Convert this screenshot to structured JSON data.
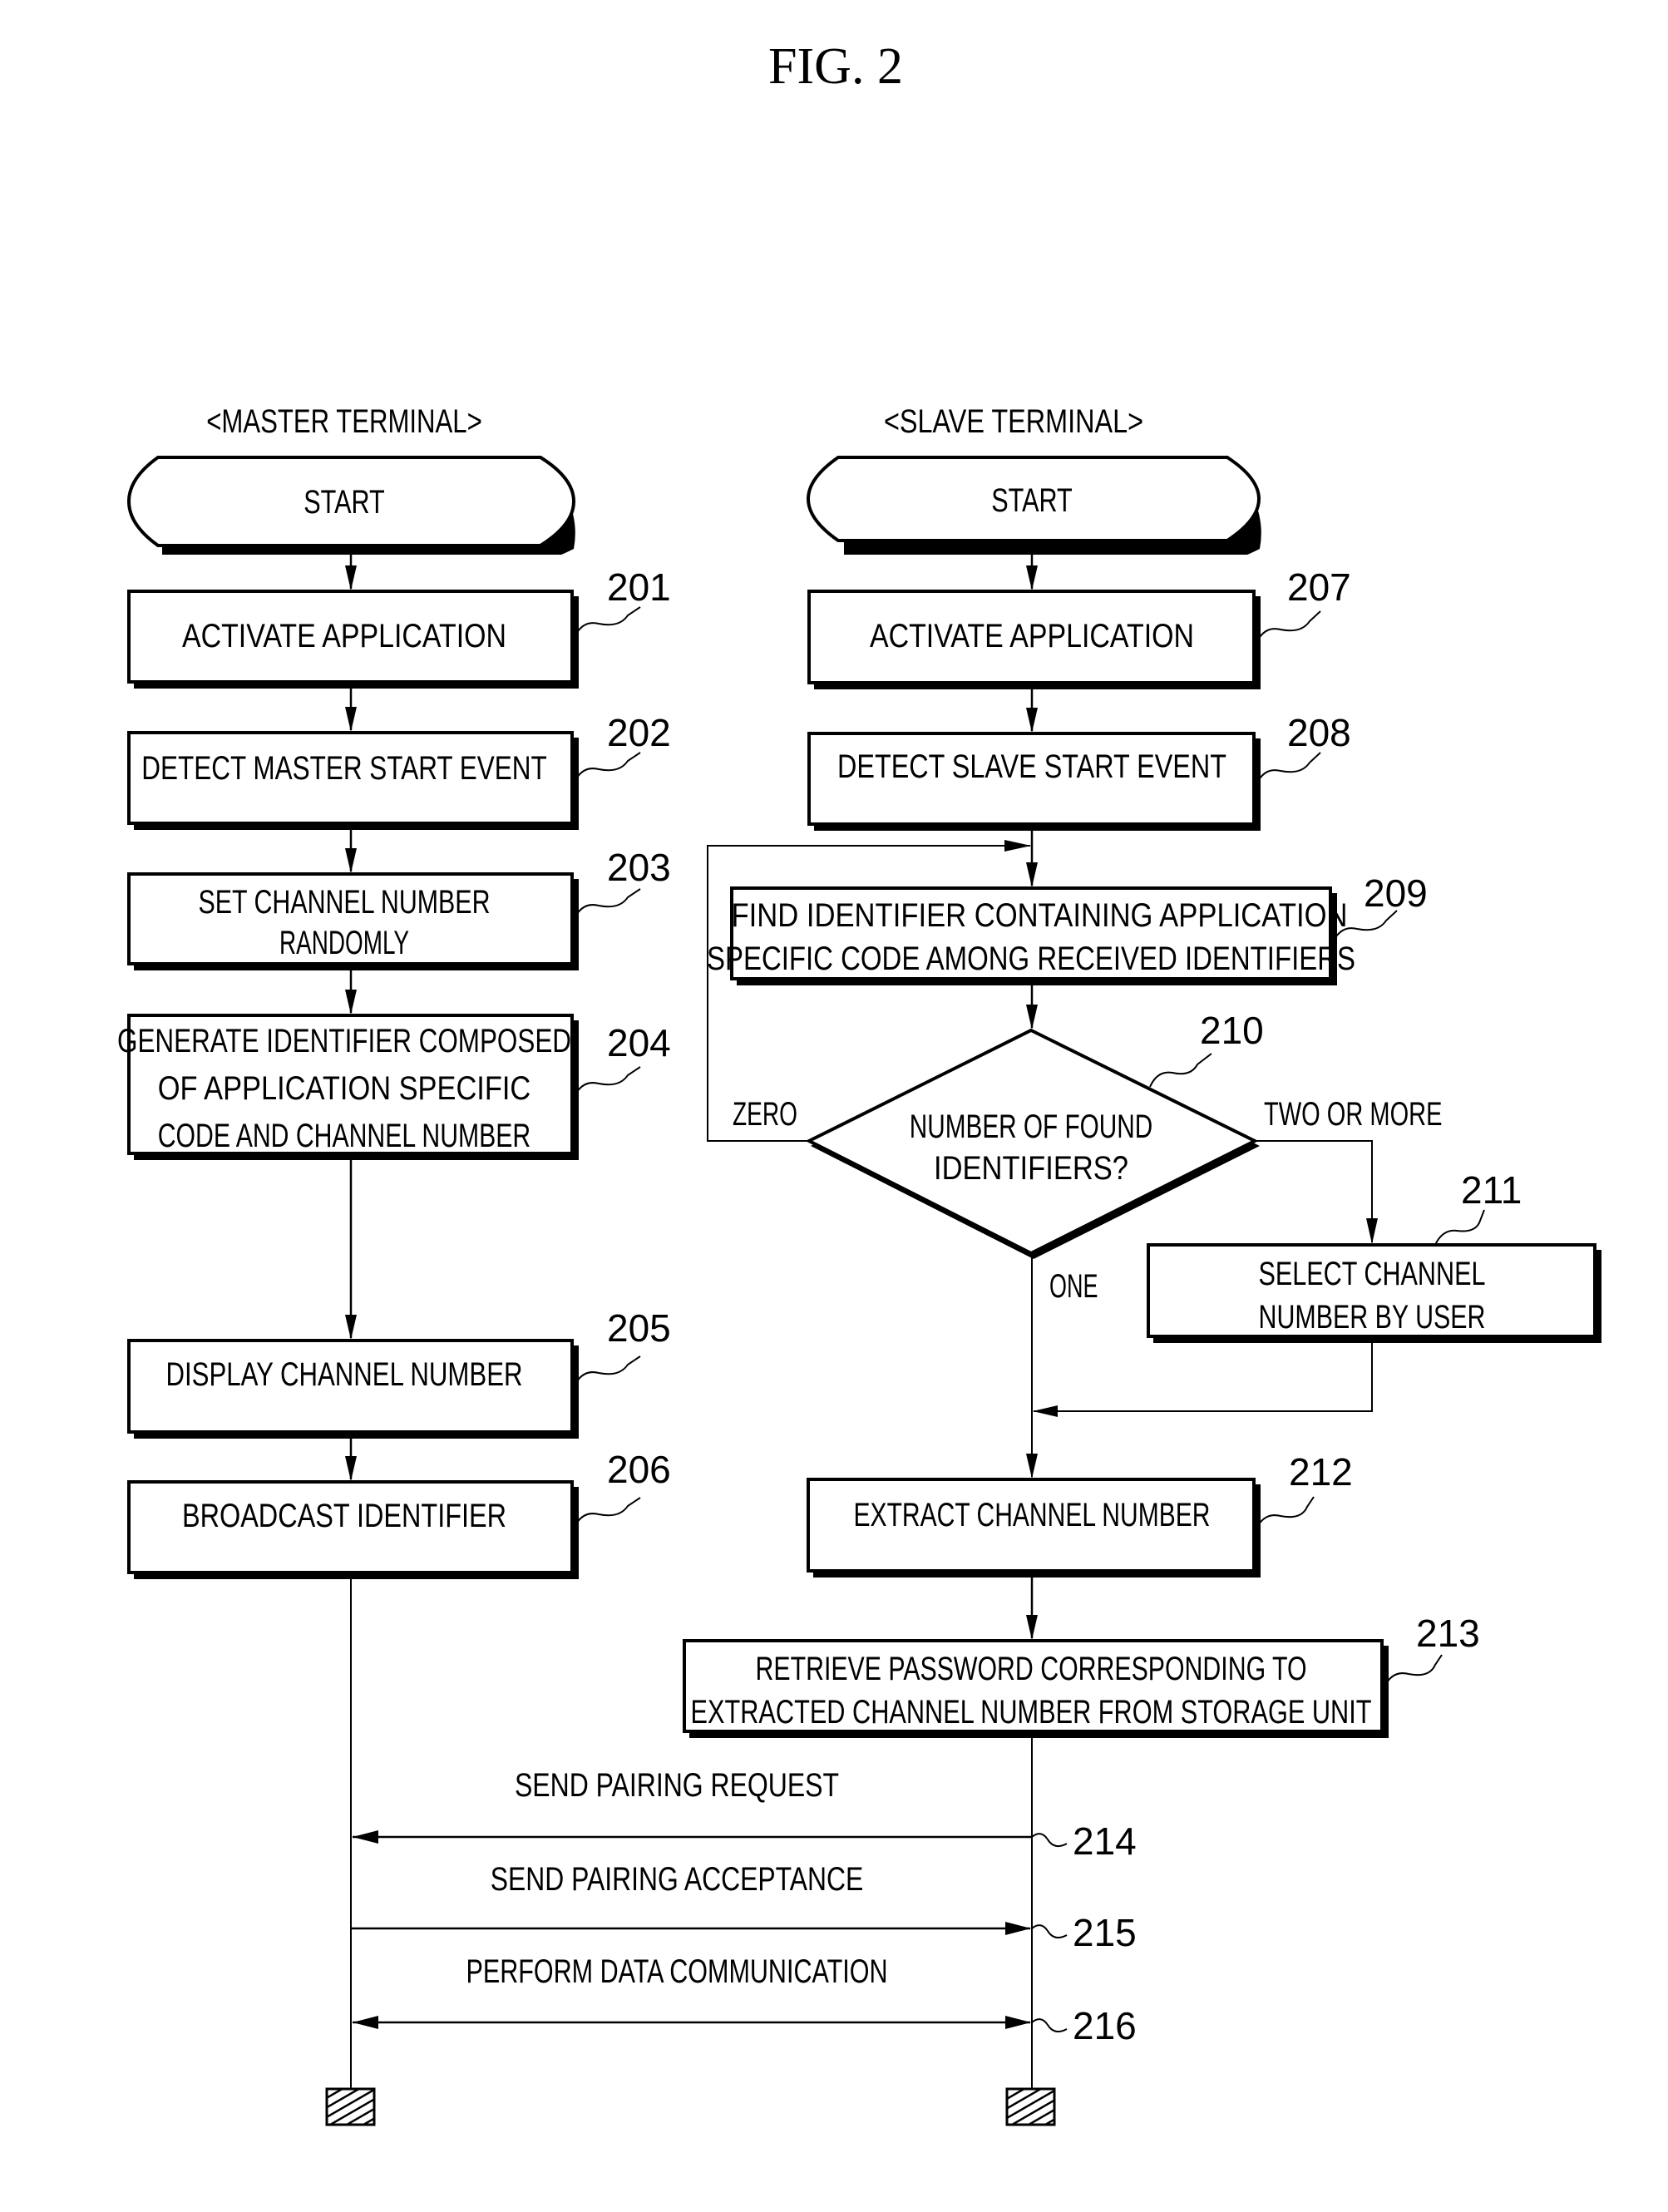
{
  "figure": {
    "title": "FIG. 2"
  },
  "lanes": {
    "master": {
      "header": "<MASTER TERMINAL>"
    },
    "slave": {
      "header": "<SLAVE TERMINAL>"
    }
  },
  "master_steps": {
    "start": {
      "lines": [
        "START"
      ]
    },
    "s201": {
      "ref": "201",
      "lines": [
        "ACTIVATE APPLICATION"
      ]
    },
    "s202": {
      "ref": "202",
      "lines": [
        "DETECT MASTER START EVENT"
      ]
    },
    "s203": {
      "ref": "203",
      "lines": [
        "SET CHANNEL NUMBER",
        "RANDOMLY"
      ]
    },
    "s204": {
      "ref": "204",
      "lines": [
        "GENERATE IDENTIFIER COMPOSED",
        "OF APPLICATION SPECIFIC",
        "CODE AND CHANNEL NUMBER"
      ]
    },
    "s205": {
      "ref": "205",
      "lines": [
        "DISPLAY CHANNEL NUMBER"
      ]
    },
    "s206": {
      "ref": "206",
      "lines": [
        "BROADCAST IDENTIFIER"
      ]
    }
  },
  "slave_steps": {
    "start": {
      "lines": [
        "START"
      ]
    },
    "s207": {
      "ref": "207",
      "lines": [
        "ACTIVATE APPLICATION"
      ]
    },
    "s208": {
      "ref": "208",
      "lines": [
        "DETECT SLAVE START EVENT"
      ]
    },
    "s209": {
      "ref": "209",
      "lines": [
        "FIND IDENTIFIER CONTAINING APPLICATION",
        "SPECIFIC CODE AMONG RECEIVED IDENTIFIERS"
      ]
    },
    "s210": {
      "ref": "210",
      "lines": [
        "NUMBER OF FOUND",
        "IDENTIFIERS?"
      ]
    },
    "s211": {
      "ref": "211",
      "lines": [
        "SELECT CHANNEL",
        "NUMBER BY USER"
      ]
    },
    "s212": {
      "ref": "212",
      "lines": [
        "EXTRACT CHANNEL NUMBER"
      ]
    },
    "s213": {
      "ref": "213",
      "lines": [
        "RETRIEVE PASSWORD CORRESPONDING TO",
        "EXTRACTED CHANNEL NUMBER FROM STORAGE UNIT"
      ]
    }
  },
  "decision_branches": {
    "zero": "ZERO",
    "one": "ONE",
    "two_or_more": "TWO OR MORE"
  },
  "messages": [
    {
      "ref": "214",
      "label": "SEND PAIRING REQUEST",
      "direction": "slave-to-master"
    },
    {
      "ref": "215",
      "label": "SEND PAIRING ACCEPTANCE",
      "direction": "master-to-slave"
    },
    {
      "ref": "216",
      "label": "PERFORM DATA COMMUNICATION",
      "direction": "bidirectional"
    }
  ]
}
